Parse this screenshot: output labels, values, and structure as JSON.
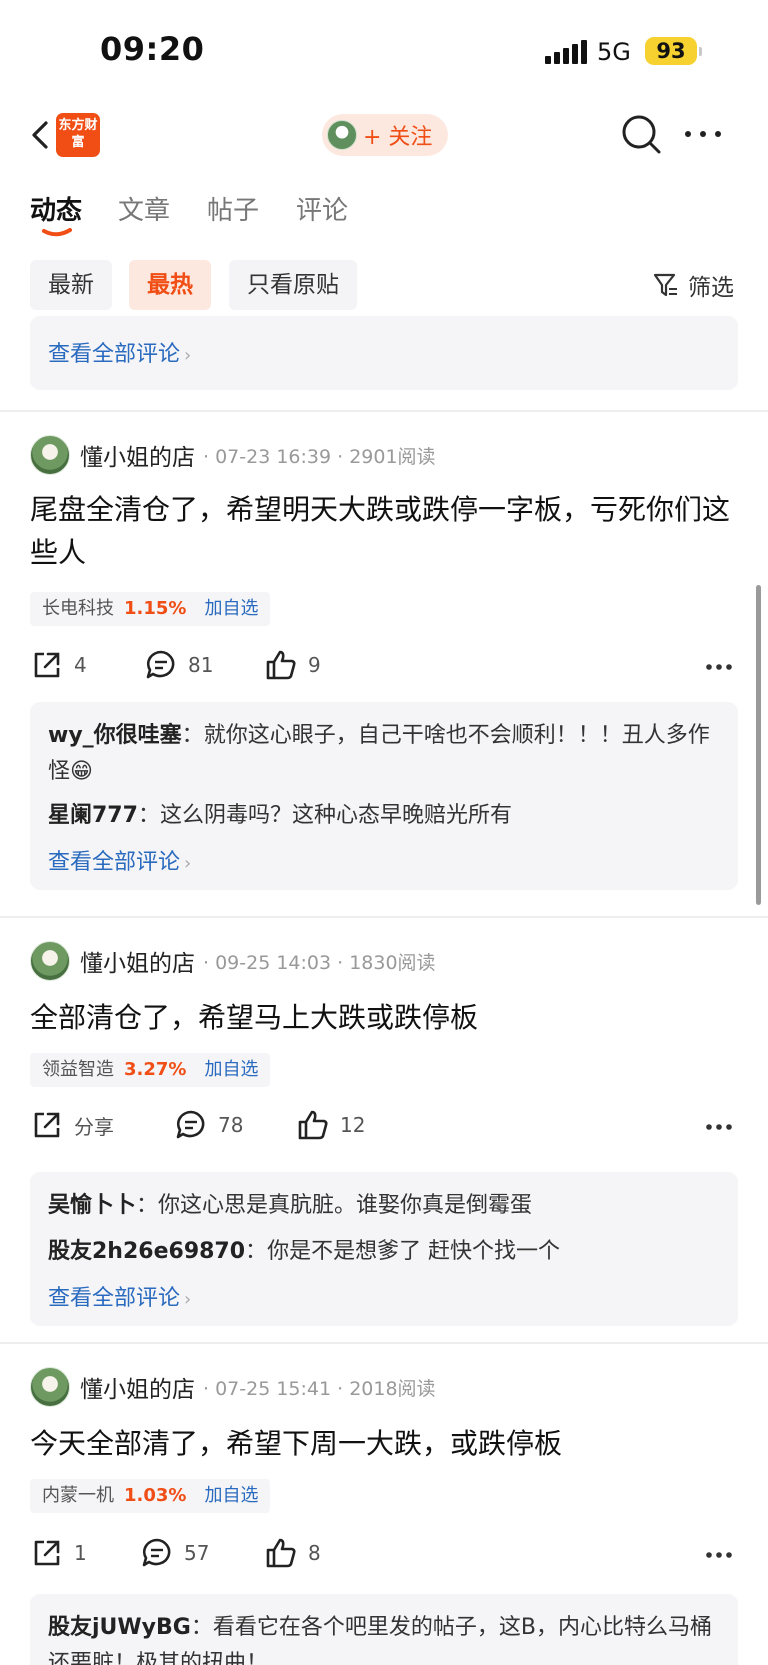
{
  "status": {
    "time": "09:20",
    "network": "5G",
    "battery": "93"
  },
  "nav": {
    "logo_text": "东方财富",
    "follow_label": "+ 关注"
  },
  "tabs": [
    "动态",
    "文章",
    "帖子",
    "评论"
  ],
  "filters": {
    "chips": [
      "最新",
      "最热",
      "只看原贴"
    ],
    "active": "最热",
    "filter_label": "筛选"
  },
  "common": {
    "view_all": "查看全部评论",
    "add_watch": "加自选"
  },
  "posts": [
    {
      "author": "懂小姐的店",
      "meta": "· 07-23 16:39 · 2901阅读",
      "text": "尾盘全清仓了，希望明天大跌或跌停一字板，亏死你们这些人",
      "stock": {
        "name": "长电科技",
        "pct": "1.15%"
      },
      "share": "4",
      "comments": "81",
      "likes": "9",
      "replies": [
        {
          "name": "wy_你很哇塞",
          "text": "就你这心眼子，自己干啥也不会顺利！！！丑人多作怪😁"
        },
        {
          "name": "星阑777",
          "text": "这么阴毒吗？这种心态早晚赔光所有"
        }
      ]
    },
    {
      "author": "懂小姐的店",
      "meta": "· 09-25 14:03 · 1830阅读",
      "text": "全部清仓了，希望马上大跌或跌停板",
      "stock": {
        "name": "领益智造",
        "pct": "3.27%"
      },
      "share": "分享",
      "comments": "78",
      "likes": "12",
      "replies": [
        {
          "name": "吴愉卜卜",
          "text": "你这心思是真肮脏。谁娶你真是倒霉蛋"
        },
        {
          "name": "股友2h26e69870",
          "text": "你是不是想爹了 赶快个找一个"
        }
      ]
    },
    {
      "author": "懂小姐的店",
      "meta": "· 07-25 15:41 · 2018阅读",
      "text": "今天全部清了，希望下周一大跌，或跌停板",
      "stock": {
        "name": "内蒙一机",
        "pct": "1.03%"
      },
      "share": "1",
      "comments": "57",
      "likes": "8",
      "replies": [
        {
          "name": "股友jUWyBG",
          "text": "看看它在各个吧里发的帖子，这B，内心比特么马桶还要脏！极其的扭曲！"
        }
      ]
    }
  ]
}
